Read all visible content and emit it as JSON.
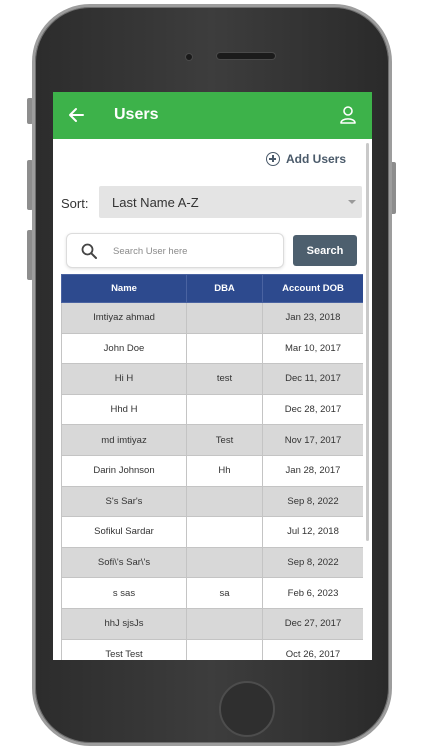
{
  "header": {
    "title": "Users"
  },
  "actions": {
    "add_users_label": "Add Users"
  },
  "sort": {
    "label": "Sort:",
    "selected": "Last Name A-Z"
  },
  "search": {
    "placeholder": "Search User here",
    "button_label": "Search"
  },
  "table": {
    "columns": [
      "Name",
      "DBA",
      "Account DOB"
    ],
    "rows": [
      {
        "name": "Imtiyaz ahmad",
        "dba": "",
        "dob": "Jan 23, 2018"
      },
      {
        "name": "John Doe",
        "dba": "",
        "dob": "Mar 10, 2017"
      },
      {
        "name": "Hi H",
        "dba": "test",
        "dob": "Dec 11, 2017"
      },
      {
        "name": "Hhd H",
        "dba": "",
        "dob": "Dec 28, 2017"
      },
      {
        "name": "md imtiyaz",
        "dba": "Test",
        "dob": "Nov 17, 2017"
      },
      {
        "name": "Darin Johnson",
        "dba": "Hh",
        "dob": "Jan 28, 2017"
      },
      {
        "name": "S's Sar's",
        "dba": "",
        "dob": "Sep 8, 2022"
      },
      {
        "name": "Sofikul Sardar",
        "dba": "",
        "dob": "Jul 12, 2018"
      },
      {
        "name": "Sofi\\'s Sar\\'s",
        "dba": "",
        "dob": "Sep 8, 2022"
      },
      {
        "name": "s sas",
        "dba": "sa",
        "dob": "Feb 6, 2023"
      },
      {
        "name": "hhJ sjsJs",
        "dba": "",
        "dob": "Dec 27, 2017"
      },
      {
        "name": "Test Test",
        "dba": "",
        "dob": "Oct 26, 2017"
      }
    ]
  },
  "icons": {
    "back": "arrow-left-icon",
    "profile": "user-icon",
    "add": "plus-circle-icon",
    "search": "search-icon",
    "dropdown": "chevron-down-icon"
  },
  "colors": {
    "app_bar": "#3db24a",
    "table_header": "#2d4a8e",
    "search_button": "#4d5f6e",
    "row_shade": "#d8d8d8"
  }
}
